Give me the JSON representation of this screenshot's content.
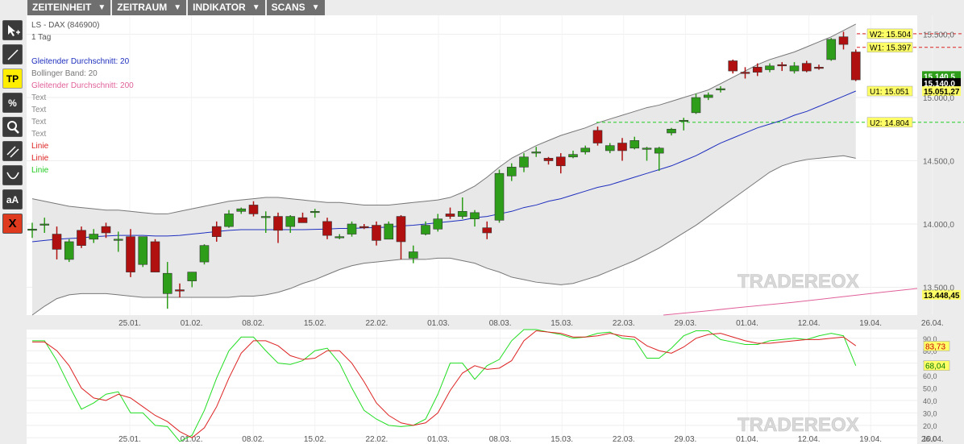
{
  "menu": [
    {
      "label": "ZEITEINHEIT",
      "icon": "caret-down-icon"
    },
    {
      "label": "ZEITRAUM",
      "icon": "caret-down-icon"
    },
    {
      "label": "INDIKATOR",
      "icon": "caret-down-icon"
    },
    {
      "label": "SCANS",
      "icon": "caret-down-icon"
    }
  ],
  "toolbar": [
    {
      "name": "pointer-add-tool",
      "icon": "cursor-plus-icon",
      "label": ""
    },
    {
      "name": "line-tool",
      "icon": "line-icon",
      "label": ""
    },
    {
      "name": "tp-tool",
      "icon": "",
      "label": "TP"
    },
    {
      "name": "percent-tool",
      "icon": "",
      "label": "%"
    },
    {
      "name": "zoom-tool",
      "icon": "magnifier-icon",
      "label": ""
    },
    {
      "name": "channel-tool",
      "icon": "parallel-lines-icon",
      "label": ""
    },
    {
      "name": "arc-tool",
      "icon": "arc-icon",
      "label": ""
    },
    {
      "name": "text-tool",
      "icon": "",
      "label": "aA"
    },
    {
      "name": "delete-tool",
      "icon": "",
      "label": "X"
    }
  ],
  "legend": {
    "title": "LS - DAX (846900)",
    "interval": "1 Tag",
    "items": [
      {
        "label": "Gleitender Durchschnitt: 20",
        "color": "#1f2fbf"
      },
      {
        "label": "Bollinger Band: 20",
        "color": "#777777"
      },
      {
        "label": "Gleitender Durchschnitt: 200",
        "color": "#e0609a"
      },
      {
        "label": "Text",
        "color": "#888888"
      },
      {
        "label": "Text",
        "color": "#888888"
      },
      {
        "label": "Text",
        "color": "#888888"
      },
      {
        "label": "Text",
        "color": "#888888"
      },
      {
        "label": "Linie",
        "color": "#dd2222"
      },
      {
        "label": "Linie",
        "color": "#dd2222"
      },
      {
        "label": "Linie",
        "color": "#22cc22"
      }
    ]
  },
  "watermark": "TRADEREOX",
  "colors": {
    "up": "#2e9e1a",
    "down": "#b01010",
    "ma20": "#1f2fbf",
    "ma200": "#e0609a",
    "band": "#777777",
    "stoch_k": "#22dd22",
    "stoch_d": "#dd2222"
  },
  "chart_data": [
    {
      "type": "candlestick",
      "x_tick_labels": [
        "25.01.",
        "01.02.",
        "08.02.",
        "15.02.",
        "22.02.",
        "01.03.",
        "08.03.",
        "15.03.",
        "22.03.",
        "29.03.",
        "01.04.",
        "12.04.",
        "19.04.",
        "26.04."
      ],
      "y_tick_labels": [
        "13.500,0",
        "14.000,0",
        "14.500,0",
        "15.000,0",
        "15.500,0"
      ],
      "ylim": [
        13280,
        15650
      ],
      "candles": [
        {
          "o": 13950,
          "h": 14010,
          "l": 13890,
          "c": 13960
        },
        {
          "o": 14000,
          "h": 14050,
          "l": 13930,
          "c": 14000
        },
        {
          "o": 13920,
          "h": 13980,
          "l": 13720,
          "c": 13800
        },
        {
          "o": 13720,
          "h": 13880,
          "l": 13700,
          "c": 13860
        },
        {
          "o": 13950,
          "h": 13980,
          "l": 13810,
          "c": 13830
        },
        {
          "o": 13880,
          "h": 13960,
          "l": 13850,
          "c": 13920
        },
        {
          "o": 13980,
          "h": 14010,
          "l": 13890,
          "c": 13930
        },
        {
          "o": 13880,
          "h": 13940,
          "l": 13780,
          "c": 13880
        },
        {
          "o": 13900,
          "h": 13960,
          "l": 13580,
          "c": 13620
        },
        {
          "o": 13680,
          "h": 13900,
          "l": 13660,
          "c": 13900
        },
        {
          "o": 13860,
          "h": 13880,
          "l": 13620,
          "c": 13620
        },
        {
          "o": 13450,
          "h": 13700,
          "l": 13330,
          "c": 13610
        },
        {
          "o": 13480,
          "h": 13530,
          "l": 13420,
          "c": 13470
        },
        {
          "o": 13550,
          "h": 13620,
          "l": 13500,
          "c": 13620
        },
        {
          "o": 13700,
          "h": 13840,
          "l": 13680,
          "c": 13830
        },
        {
          "o": 13980,
          "h": 14020,
          "l": 13860,
          "c": 13900
        },
        {
          "o": 13980,
          "h": 14110,
          "l": 13970,
          "c": 14080
        },
        {
          "o": 14100,
          "h": 14130,
          "l": 14080,
          "c": 14120
        },
        {
          "o": 14150,
          "h": 14180,
          "l": 14060,
          "c": 14080
        },
        {
          "o": 14060,
          "h": 14100,
          "l": 13930,
          "c": 14060
        },
        {
          "o": 14060,
          "h": 14090,
          "l": 13850,
          "c": 13950
        },
        {
          "o": 13980,
          "h": 14070,
          "l": 13930,
          "c": 14060
        },
        {
          "o": 14050,
          "h": 14090,
          "l": 14020,
          "c": 14010
        },
        {
          "o": 14100,
          "h": 14120,
          "l": 14050,
          "c": 14100
        },
        {
          "o": 14020,
          "h": 14050,
          "l": 13880,
          "c": 13910
        },
        {
          "o": 13900,
          "h": 13920,
          "l": 13880,
          "c": 13900
        },
        {
          "o": 13920,
          "h": 14020,
          "l": 13900,
          "c": 14000
        },
        {
          "o": 13980,
          "h": 14000,
          "l": 13960,
          "c": 13970
        },
        {
          "o": 13990,
          "h": 14020,
          "l": 13830,
          "c": 13870
        },
        {
          "o": 13880,
          "h": 14020,
          "l": 13880,
          "c": 14000
        },
        {
          "o": 14060,
          "h": 14070,
          "l": 13720,
          "c": 13860
        },
        {
          "o": 13730,
          "h": 13830,
          "l": 13690,
          "c": 13780
        },
        {
          "o": 13920,
          "h": 14020,
          "l": 13910,
          "c": 13990
        },
        {
          "o": 13960,
          "h": 14080,
          "l": 13940,
          "c": 14040
        },
        {
          "o": 14080,
          "h": 14130,
          "l": 14040,
          "c": 14060
        },
        {
          "o": 14060,
          "h": 14210,
          "l": 14040,
          "c": 14100
        },
        {
          "o": 14040,
          "h": 14110,
          "l": 13980,
          "c": 14090
        },
        {
          "o": 13970,
          "h": 14020,
          "l": 13880,
          "c": 13930
        },
        {
          "o": 14030,
          "h": 14430,
          "l": 14010,
          "c": 14400
        },
        {
          "o": 14380,
          "h": 14480,
          "l": 14340,
          "c": 14450
        },
        {
          "o": 14450,
          "h": 14560,
          "l": 14410,
          "c": 14530
        },
        {
          "o": 14570,
          "h": 14610,
          "l": 14530,
          "c": 14570
        },
        {
          "o": 14520,
          "h": 14530,
          "l": 14470,
          "c": 14500
        },
        {
          "o": 14530,
          "h": 14560,
          "l": 14400,
          "c": 14460
        },
        {
          "o": 14530,
          "h": 14580,
          "l": 14520,
          "c": 14550
        },
        {
          "o": 14570,
          "h": 14620,
          "l": 14550,
          "c": 14600
        },
        {
          "o": 14740,
          "h": 14770,
          "l": 14620,
          "c": 14640
        },
        {
          "o": 14580,
          "h": 14640,
          "l": 14560,
          "c": 14620
        },
        {
          "o": 14640,
          "h": 14680,
          "l": 14500,
          "c": 14580
        },
        {
          "o": 14600,
          "h": 14690,
          "l": 14590,
          "c": 14660
        },
        {
          "o": 14600,
          "h": 14610,
          "l": 14500,
          "c": 14600
        },
        {
          "o": 14560,
          "h": 14610,
          "l": 14420,
          "c": 14600
        },
        {
          "o": 14720,
          "h": 14760,
          "l": 14700,
          "c": 14750
        },
        {
          "o": 14820,
          "h": 14840,
          "l": 14740,
          "c": 14820
        },
        {
          "o": 14880,
          "h": 15030,
          "l": 14870,
          "c": 15000
        },
        {
          "o": 15000,
          "h": 15040,
          "l": 14980,
          "c": 15020
        },
        {
          "o": 15060,
          "h": 15090,
          "l": 15040,
          "c": 15070
        },
        {
          "o": 15290,
          "h": 15300,
          "l": 15190,
          "c": 15210
        },
        {
          "o": 15200,
          "h": 15240,
          "l": 15150,
          "c": 15190
        },
        {
          "o": 15240,
          "h": 15270,
          "l": 15170,
          "c": 15200
        },
        {
          "o": 15220,
          "h": 15270,
          "l": 15200,
          "c": 15250
        },
        {
          "o": 15260,
          "h": 15280,
          "l": 15210,
          "c": 15250
        },
        {
          "o": 15210,
          "h": 15280,
          "l": 15190,
          "c": 15250
        },
        {
          "o": 15270,
          "h": 15290,
          "l": 15200,
          "c": 15210
        },
        {
          "o": 15240,
          "h": 15260,
          "l": 15220,
          "c": 15230
        },
        {
          "o": 15300,
          "h": 15470,
          "l": 15290,
          "c": 15460
        },
        {
          "o": 15480,
          "h": 15520,
          "l": 15380,
          "c": 15420
        },
        {
          "o": 15360,
          "h": 15380,
          "l": 15130,
          "c": 15140
        }
      ],
      "ma20": [
        13860,
        13870,
        13880,
        13885,
        13890,
        13900,
        13905,
        13910,
        13910,
        13910,
        13905,
        13905,
        13910,
        13920,
        13930,
        13940,
        13950,
        13955,
        13955,
        13955,
        13955,
        13955,
        13955,
        13958,
        13960,
        13965,
        13965,
        13970,
        13972,
        13975,
        13985,
        13990,
        14000,
        14010,
        14020,
        14030,
        14050,
        14060,
        14080,
        14100,
        14130,
        14150,
        14180,
        14200,
        14230,
        14260,
        14290,
        14310,
        14340,
        14370,
        14400,
        14430,
        14460,
        14500,
        14540,
        14590,
        14640,
        14680,
        14720,
        14760,
        14790,
        14820,
        14860,
        14890,
        14930,
        14970,
        15010,
        15051
      ],
      "bb_upper": [
        14200,
        14180,
        14160,
        14140,
        14130,
        14120,
        14110,
        14110,
        14100,
        14090,
        14080,
        14080,
        14100,
        14120,
        14140,
        14160,
        14180,
        14190,
        14200,
        14210,
        14210,
        14200,
        14190,
        14180,
        14170,
        14170,
        14160,
        14150,
        14150,
        14150,
        14160,
        14170,
        14180,
        14190,
        14210,
        14250,
        14300,
        14370,
        14450,
        14520,
        14570,
        14620,
        14660,
        14700,
        14730,
        14760,
        14800,
        14830,
        14860,
        14890,
        14920,
        14940,
        14970,
        15000,
        15030,
        15060,
        15110,
        15160,
        15210,
        15260,
        15300,
        15330,
        15360,
        15400,
        15440,
        15480,
        15530,
        15580
      ],
      "bb_lower": [
        13280,
        13350,
        13410,
        13440,
        13450,
        13450,
        13450,
        13440,
        13430,
        13420,
        13420,
        13420,
        13420,
        13420,
        13420,
        13420,
        13420,
        13430,
        13430,
        13440,
        13460,
        13490,
        13530,
        13560,
        13600,
        13640,
        13670,
        13690,
        13700,
        13710,
        13720,
        13720,
        13720,
        13730,
        13730,
        13710,
        13690,
        13650,
        13620,
        13580,
        13560,
        13540,
        13530,
        13520,
        13530,
        13560,
        13590,
        13630,
        13670,
        13710,
        13760,
        13810,
        13870,
        13930,
        13990,
        14060,
        14130,
        14200,
        14270,
        14340,
        14410,
        14460,
        14490,
        14510,
        14520,
        14530,
        14540,
        14520
      ],
      "ma200": [
        {
          "x": 0.715,
          "y": 13280
        },
        {
          "x": 0.76,
          "y": 13310
        },
        {
          "x": 0.8,
          "y": 13340
        },
        {
          "x": 0.86,
          "y": 13380
        },
        {
          "x": 0.91,
          "y": 13420
        },
        {
          "x": 0.96,
          "y": 13460
        },
        {
          "x": 1.0,
          "y": 13490
        }
      ],
      "levels": [
        {
          "name": "W2",
          "value": 15504,
          "label": "W2: 15.504",
          "color": "#dd2222"
        },
        {
          "name": "W1",
          "value": 15397,
          "label": "W1: 15.397",
          "color": "#dd2222"
        },
        {
          "name": "U1",
          "value": 15051,
          "label": "U1: 15.051",
          "color": "#1f2fbf"
        },
        {
          "name": "U2",
          "value": 14804,
          "label": "U2: 14.804",
          "color": "#22cc22"
        }
      ],
      "price_labels": [
        {
          "text": "15.140,5",
          "value": 15170,
          "bg": "#2e9e1a",
          "fg": "#ffffff"
        },
        {
          "text": "15.140,0",
          "value": 15115,
          "bg": "#000000",
          "fg": "#ffffff"
        },
        {
          "text": "15.051,27",
          "value": 15051,
          "bg": "#ffff66",
          "fg": "#000000"
        },
        {
          "text": "13.448,45",
          "value": 13440,
          "bg": "#ffff66",
          "fg": "#000000"
        }
      ]
    },
    {
      "type": "line",
      "name": "stochastic",
      "y_tick_labels": [
        "10,0",
        "20,0",
        "30,0",
        "40,0",
        "50,0",
        "60,0",
        "70,0",
        "80,0",
        "90,0"
      ],
      "ylim": [
        5,
        97
      ],
      "k": [
        88,
        88,
        72,
        52,
        33,
        38,
        45,
        47,
        30,
        30,
        20,
        19,
        7,
        12,
        32,
        58,
        80,
        91,
        91,
        80,
        70,
        69,
        72,
        80,
        82,
        70,
        50,
        32,
        25,
        20,
        19,
        20,
        25,
        45,
        70,
        70,
        57,
        68,
        73,
        88,
        97,
        97,
        95,
        93,
        90,
        91,
        94,
        95,
        90,
        89,
        74,
        74,
        82,
        92,
        96,
        96,
        89,
        87,
        85,
        85,
        88,
        89,
        90,
        89,
        92,
        94,
        92,
        68
      ],
      "d": [
        87,
        87,
        80,
        68,
        50,
        42,
        40,
        45,
        42,
        35,
        28,
        23,
        15,
        10,
        18,
        35,
        58,
        78,
        88,
        88,
        84,
        76,
        73,
        74,
        80,
        80,
        70,
        55,
        38,
        28,
        22,
        20,
        22,
        30,
        48,
        62,
        68,
        65,
        66,
        72,
        88,
        96,
        95,
        94,
        91,
        91,
        92,
        94,
        92,
        91,
        84,
        80,
        78,
        83,
        90,
        93,
        94,
        91,
        88,
        86,
        86,
        87,
        88,
        89,
        89,
        90,
        91,
        84
      ],
      "labels": [
        {
          "text": "83,73",
          "value": 83.73,
          "bg": "#ffff66",
          "fg": "#cc0000"
        },
        {
          "text": "68,04",
          "value": 68.04,
          "bg": "#ffff66",
          "fg": "#007700"
        }
      ]
    }
  ]
}
